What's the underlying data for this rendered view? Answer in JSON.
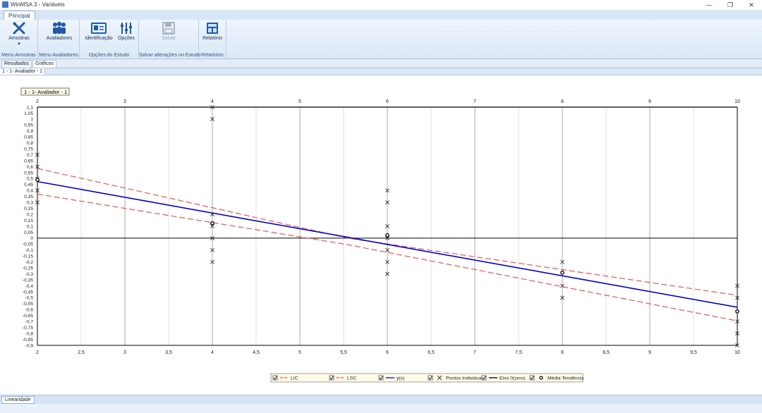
{
  "window": {
    "title": "WinMSA 3 - Variáveis",
    "minimize": "—",
    "restore": "❐",
    "close": "✕"
  },
  "ribbon": {
    "tab": "Principal",
    "groups": [
      {
        "label": "Menu Amostras",
        "buttons": [
          {
            "label": "Amostras",
            "icon": "cross-tools-icon"
          }
        ]
      },
      {
        "label": "Menu Avaliadores",
        "buttons": [
          {
            "label": "Avaliadores",
            "icon": "people-icon"
          }
        ]
      },
      {
        "label": "Opções do Estudo",
        "buttons": [
          {
            "label": "Identificação",
            "icon": "id-card-icon"
          },
          {
            "label": "Opções",
            "icon": "sliders-icon"
          }
        ]
      },
      {
        "label": "Salvar alterações no Estudo",
        "buttons": [
          {
            "label": "Salvar",
            "icon": "save-icon"
          }
        ]
      },
      {
        "label": "Relatórios",
        "buttons": [
          {
            "label": "Relatório",
            "icon": "report-icon"
          }
        ]
      }
    ]
  },
  "subtabs": [
    "Resultados",
    "Gráficos"
  ],
  "appraiser_tab": "1 - 1- Avaliador - 1",
  "bottom_tab": "Linearidade",
  "chart_data": {
    "type": "scatter",
    "title": "1 - 1- Avaliador - 1",
    "xlim": [
      2,
      10
    ],
    "ylim": [
      -0.9,
      1.1
    ],
    "x_ticks_top": [
      2,
      3,
      4,
      5,
      6,
      7,
      8,
      9,
      10
    ],
    "x_ticks_bottom": [
      2,
      2.5,
      3,
      3.5,
      4,
      4.5,
      5,
      5.5,
      6,
      6.5,
      7,
      7.5,
      8,
      8.5,
      9,
      9.5,
      10
    ],
    "y_ticks": [
      1.1,
      1.05,
      1,
      0.95,
      0.9,
      0.85,
      0.8,
      0.75,
      0.7,
      0.65,
      0.6,
      0.55,
      0.5,
      0.45,
      0.4,
      0.35,
      0.3,
      0.25,
      0.2,
      0.15,
      0.1,
      0.05,
      0,
      -0.05,
      -0.1,
      -0.15,
      -0.2,
      -0.25,
      -0.3,
      -0.35,
      -0.4,
      -0.45,
      -0.5,
      -0.55,
      -0.6,
      -0.65,
      -0.7,
      -0.75,
      -0.8,
      -0.85,
      -0.9
    ],
    "grid": true,
    "individual_points": [
      {
        "x": 2,
        "y": 0.7
      },
      {
        "x": 2,
        "y": 0.6
      },
      {
        "x": 2,
        "y": 0.5
      },
      {
        "x": 2,
        "y": 0.4
      },
      {
        "x": 2,
        "y": 0.3
      },
      {
        "x": 4,
        "y": 1.1
      },
      {
        "x": 4,
        "y": 1.0
      },
      {
        "x": 4,
        "y": 0.2
      },
      {
        "x": 4,
        "y": 0.1
      },
      {
        "x": 4,
        "y": 0.0
      },
      {
        "x": 4,
        "y": -0.1
      },
      {
        "x": 4,
        "y": -0.2
      },
      {
        "x": 6,
        "y": 0.4
      },
      {
        "x": 6,
        "y": 0.3
      },
      {
        "x": 6,
        "y": 0.1
      },
      {
        "x": 6,
        "y": 0.0
      },
      {
        "x": 6,
        "y": -0.1
      },
      {
        "x": 6,
        "y": -0.2
      },
      {
        "x": 6,
        "y": -0.3
      },
      {
        "x": 8,
        "y": -0.2
      },
      {
        "x": 8,
        "y": -0.4
      },
      {
        "x": 8,
        "y": -0.5
      },
      {
        "x": 10,
        "y": -0.4
      },
      {
        "x": 10,
        "y": -0.5
      },
      {
        "x": 10,
        "y": -0.7
      },
      {
        "x": 10,
        "y": -0.8
      },
      {
        "x": 10,
        "y": -0.9
      }
    ],
    "mean_trend": [
      {
        "x": 2,
        "y": 0.49
      },
      {
        "x": 4,
        "y": 0.125
      },
      {
        "x": 6,
        "y": 0.025
      },
      {
        "x": 8,
        "y": -0.29
      },
      {
        "x": 10,
        "y": -0.615
      }
    ],
    "fit_line": {
      "x": [
        2,
        10
      ],
      "y": [
        0.475,
        -0.58
      ]
    },
    "lic_line": {
      "x": [
        2,
        5.55,
        10
      ],
      "y": [
        0.37,
        -0.055,
        -0.695
      ]
    },
    "lsc_line": {
      "x": [
        2,
        5.55,
        10
      ],
      "y": [
        0.585,
        0.0,
        -0.48
      ]
    },
    "zero_axis": 0,
    "colors": {
      "fit": "#0000cc",
      "limits": "#f05050",
      "points": "#333333",
      "zero": "#000000"
    },
    "legend": [
      {
        "label": "LIC",
        "kind": "dashed",
        "color": "#f05050"
      },
      {
        "label": "LSC",
        "kind": "dashed",
        "color": "#f05050"
      },
      {
        "label": "y(x)",
        "kind": "solid",
        "color": "#0000cc"
      },
      {
        "label": "Pontos Individuais",
        "kind": "cross",
        "color": "#333333"
      },
      {
        "label": "Eixo 0(zero)",
        "kind": "solid",
        "color": "#000000"
      },
      {
        "label": "Média Tendência",
        "kind": "circle",
        "color": "#000000"
      }
    ]
  }
}
